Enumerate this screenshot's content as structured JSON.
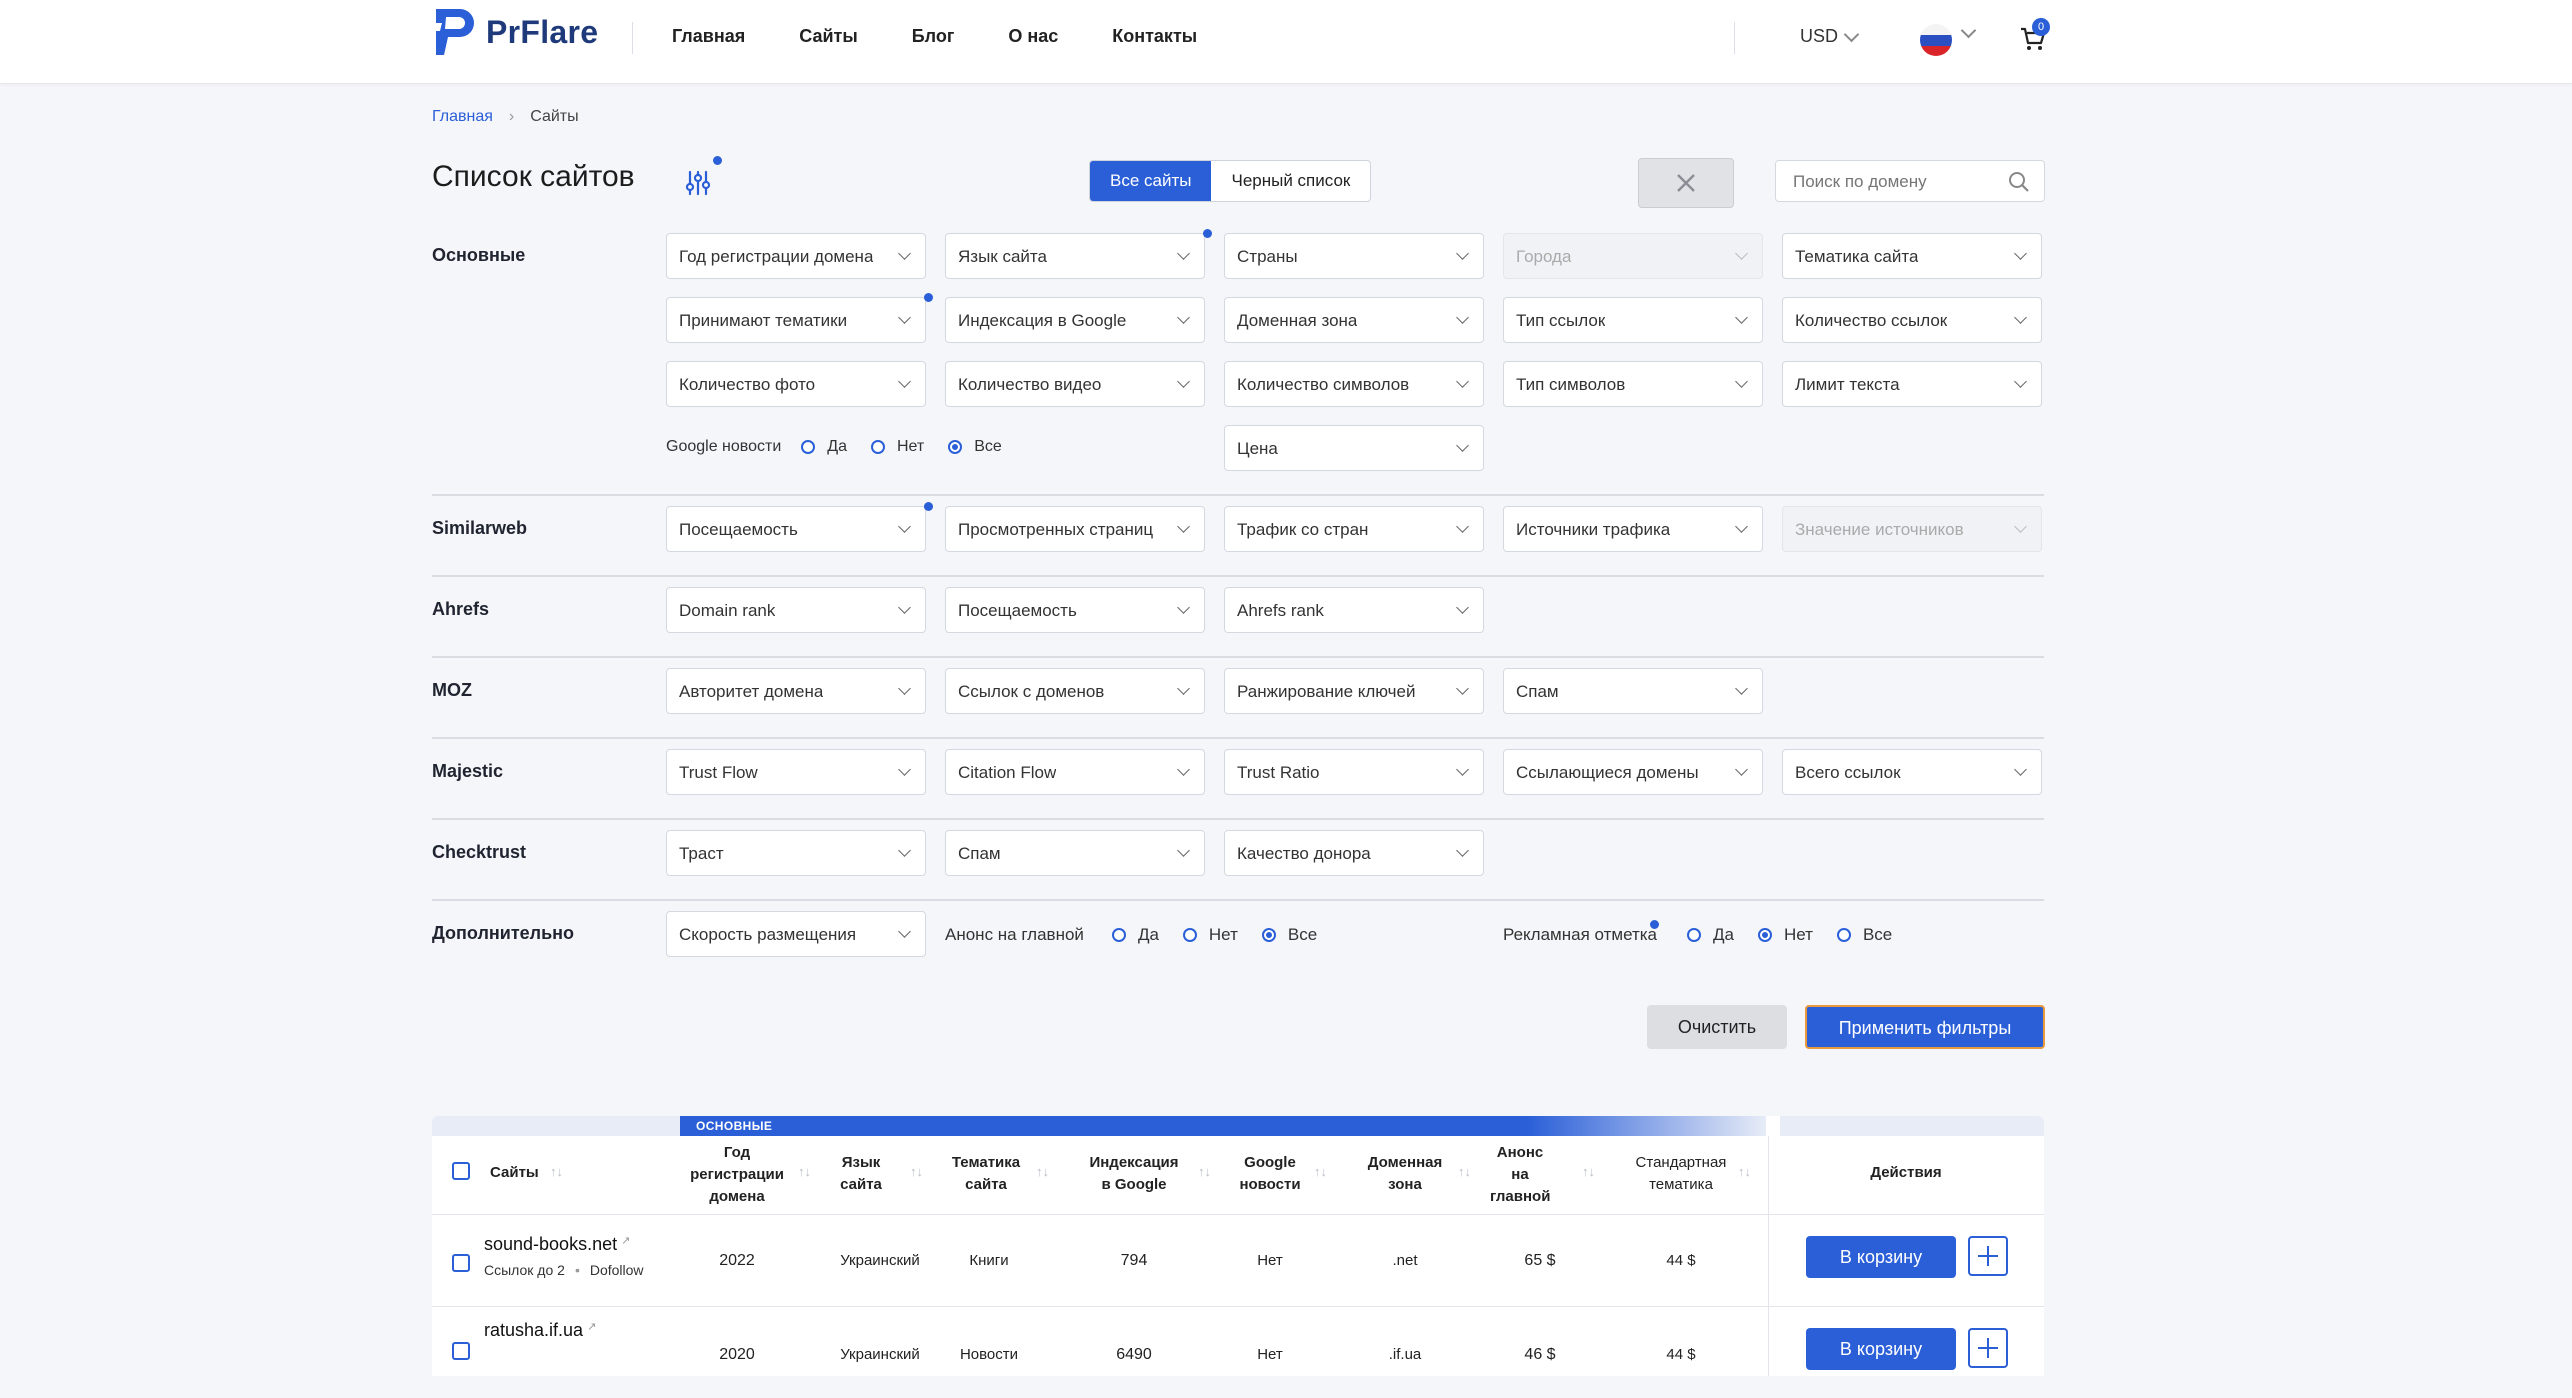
{
  "header": {
    "brand": "PrFlare",
    "nav": [
      "Главная",
      "Сайты",
      "Блог",
      "О нас",
      "Контакты"
    ],
    "currency": "USD",
    "cart_count": "0",
    "colors": {
      "accent": "#2a5fd8",
      "brand_dark": "#1f3a7a"
    }
  },
  "breadcrumb": {
    "home": "Главная",
    "current": "Сайты"
  },
  "page": {
    "title": "Список сайтов",
    "tab_all": "Все сайты",
    "tab_black": "Черный список",
    "search_placeholder": "Поиск по домену"
  },
  "filters": {
    "main": {
      "label": "Основные",
      "dropdowns": [
        "Год регистрации домена",
        "Язык сайта",
        "Страны",
        "Города",
        "Тематика сайта",
        "Принимают тематики",
        "Индексация в Google",
        "Доменная зона",
        "Тип ссылок",
        "Количество ссылок",
        "Количество фото",
        "Количество видео",
        "Количество символов",
        "Тип символов",
        "Лимит текста"
      ],
      "google_news_label": "Google новости",
      "google_news_options": [
        "Да",
        "Нет",
        "Все"
      ],
      "google_news_selected": "Все",
      "price": "Цена"
    },
    "similarweb": {
      "label": "Similarweb",
      "dropdowns": [
        "Посещаемость",
        "Просмотренных страниц",
        "Трафик со стран",
        "Источники трафика",
        "Значение источников"
      ]
    },
    "ahrefs": {
      "label": "Ahrefs",
      "dropdowns": [
        "Domain rank",
        "Посещаемость",
        "Ahrefs rank"
      ]
    },
    "moz": {
      "label": "MOZ",
      "dropdowns": [
        "Авторитет домена",
        "Ссылок с доменов",
        "Ранжирование ключей",
        "Спам"
      ]
    },
    "majestic": {
      "label": "Majestic",
      "dropdowns": [
        "Trust Flow",
        "Citation Flow",
        "Trust Ratio",
        "Ссылающиеся домены",
        "Всего ссылок"
      ]
    },
    "checktrust": {
      "label": "Checktrust",
      "dropdowns": [
        "Траст",
        "Спам",
        "Качество донора"
      ]
    },
    "extra": {
      "label": "Дополнительно",
      "speed": "Скорость размещения",
      "announce_label": "Анонс на главной",
      "announce_options": [
        "Да",
        "Нет",
        "Все"
      ],
      "announce_selected": "Все",
      "ad_label": "Рекламная отметка",
      "ad_options": [
        "Да",
        "Нет",
        "Все"
      ],
      "ad_selected": "Нет"
    },
    "clear_button": "Очистить",
    "apply_button": "Применить фильтры"
  },
  "table": {
    "group_label": "ОСНОВНЫЕ",
    "headers": {
      "site": "Сайты",
      "year": "Год регистрации домена",
      "lang": "Язык сайта",
      "topic": "Тематика сайта",
      "index": "Индексация в Google",
      "news": "Google новости",
      "zone": "Доменная зона",
      "announce": "Анонс на главной",
      "std": "Стандартная тематика",
      "actions": "Действия"
    },
    "rows": [
      {
        "site": "sound-books.net",
        "links": "Ссылок до 2",
        "follow": "Dofollow",
        "year": "2022",
        "lang": "Украинский",
        "topic": "Книги",
        "index": "794",
        "news": "Нет",
        "zone": ".net",
        "announce": "65 $",
        "std": "44 $",
        "cart": "В корзину"
      },
      {
        "site": "ratusha.if.ua",
        "links": "",
        "follow": "",
        "year": "2020",
        "lang": "Украинский",
        "topic": "Новости",
        "index": "6490",
        "news": "Нет",
        "zone": ".if.ua",
        "announce": "46 $",
        "std": "44 $",
        "cart": "В корзину"
      }
    ]
  }
}
